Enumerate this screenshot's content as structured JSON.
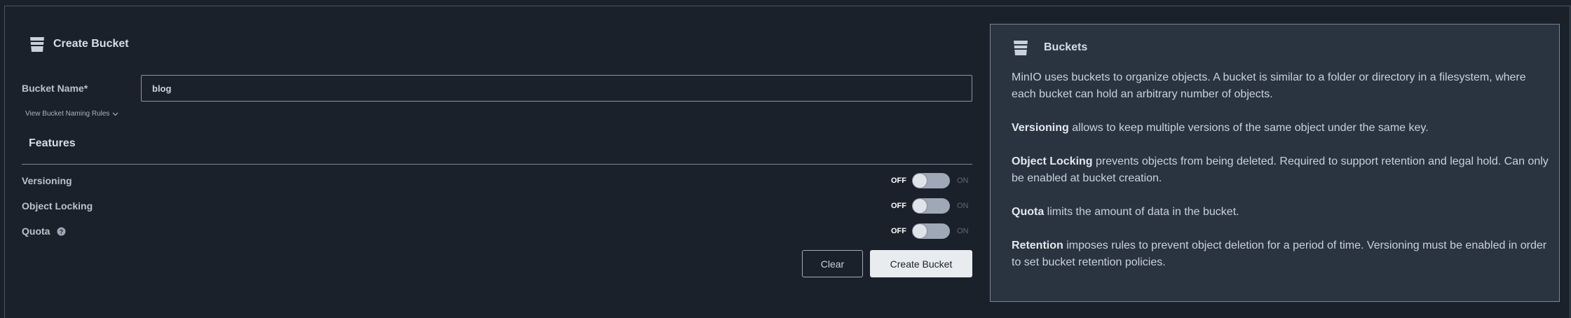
{
  "form": {
    "title": "Create Bucket",
    "bucket_name_label": "Bucket Name*",
    "bucket_name_value": "blog",
    "naming_rules_link": "View Bucket Naming Rules",
    "features_heading": "Features",
    "features": [
      {
        "label": "Versioning",
        "off_label": "OFF",
        "on_label": "ON",
        "state": "off"
      },
      {
        "label": "Object Locking",
        "off_label": "OFF",
        "on_label": "ON",
        "state": "off"
      },
      {
        "label": "Quota",
        "off_label": "OFF",
        "on_label": "ON",
        "state": "off",
        "has_help": true
      }
    ],
    "clear_label": "Clear",
    "create_label": "Create Bucket"
  },
  "info": {
    "title": "Buckets",
    "intro": "MinIO uses buckets to organize objects. A bucket is similar to a folder or directory in a filesystem, where each bucket can hold an arbitrary number of objects.",
    "items": [
      {
        "term": "Versioning",
        "text": " allows to keep multiple versions of the same object under the same key."
      },
      {
        "term": "Object Locking",
        "text": " prevents objects from being deleted. Required to support retention and legal hold. Can only be enabled at bucket creation."
      },
      {
        "term": "Quota",
        "text": " limits the amount of data in the bucket."
      },
      {
        "term": "Retention",
        "text": " imposes rules to prevent object deletion for a period of time. Versioning must be enabled in order to set bucket retention policies."
      }
    ]
  },
  "icons": {
    "bucket": "bucket-icon",
    "help": "question-circle-icon",
    "chevron": "chevron-down-icon"
  },
  "colors": {
    "background": "#1b212a",
    "panel": "#2a3340",
    "toggle_track": "#9ea8b6",
    "primary_button": "#e8ecef"
  }
}
